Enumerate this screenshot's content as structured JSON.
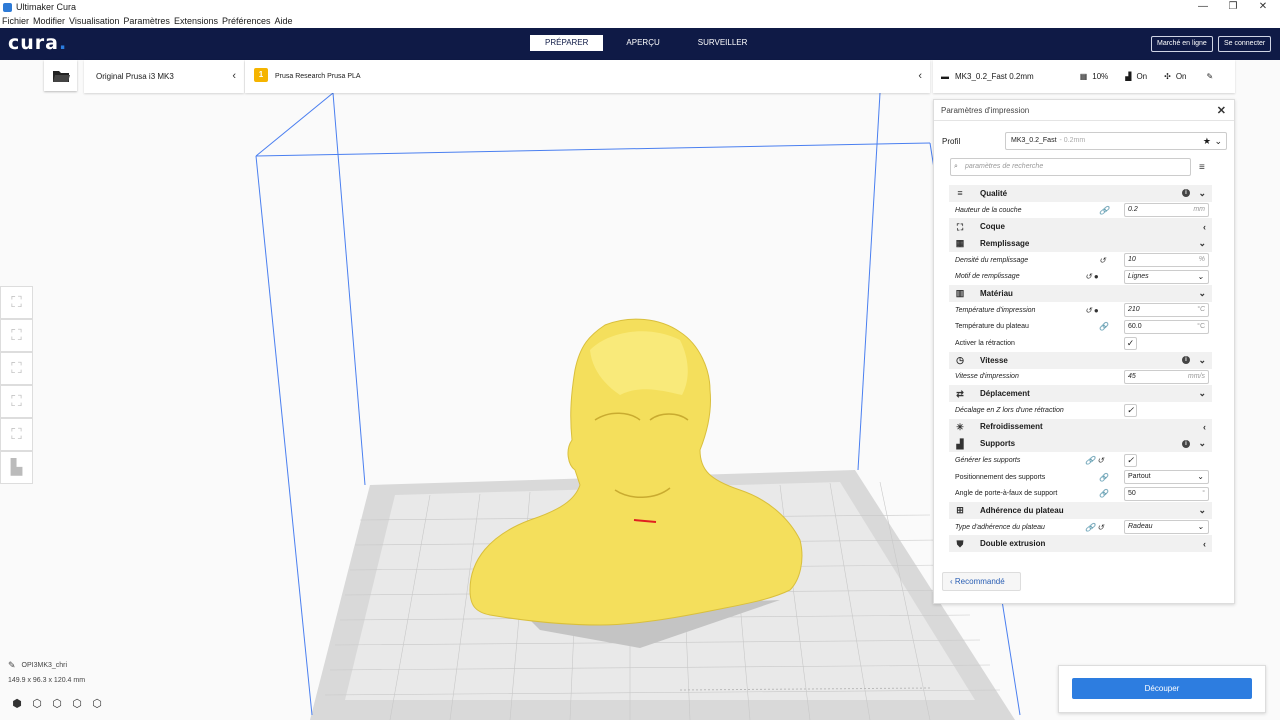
{
  "window": {
    "title": "Ultimaker Cura",
    "minimize": "—",
    "restore": "❐",
    "close": "✕"
  },
  "menu": [
    "Fichier",
    "Modifier",
    "Visualisation",
    "Paramètres",
    "Extensions",
    "Préférences",
    "Aide"
  ],
  "header": {
    "logo": "cura",
    "logo_dot": ".",
    "stages": [
      "PRÉPARER",
      "APERÇU",
      "SURVEILLER"
    ],
    "marketplace": "Marché en ligne",
    "login": "Se connecter"
  },
  "printer": {
    "name": "Original Prusa i3 MK3"
  },
  "material": {
    "badge": "1",
    "name": "Prusa Research Prusa PLA"
  },
  "summary": {
    "profile": "MK3_0.2_Fast 0.2mm",
    "infill": "10%",
    "support": "On",
    "adhesion": "On"
  },
  "panel": {
    "title": "Paramètres d'impression",
    "profile_label": "Profil",
    "profile_value": "MK3_0.2_Fast",
    "profile_sub": "- 0.2mm",
    "search_placeholder": "paramètres de recherche",
    "recommended": "Recommandé"
  },
  "settings": [
    {
      "type": "cat",
      "label": "Qualité",
      "icon": "≡",
      "info": true,
      "chev": "⌄"
    },
    {
      "type": "set",
      "label": "Hauteur de la couche",
      "italic": true,
      "icons": "🔗",
      "value": "0.2",
      "unit": "mm"
    },
    {
      "type": "cat",
      "label": "Coque",
      "icon": "⛶",
      "chev": "‹"
    },
    {
      "type": "cat",
      "label": "Remplissage",
      "icon": "▦",
      "chev": "⌄"
    },
    {
      "type": "set",
      "label": "Densité du remplissage",
      "italic": true,
      "icons": "↺",
      "value": "10",
      "unit": "%"
    },
    {
      "type": "set",
      "label": "Motif de remplissage",
      "italic": true,
      "icons": "↺ ●",
      "value": "Lignes",
      "dropdown": true
    },
    {
      "type": "cat",
      "label": "Matériau",
      "icon": "▥",
      "chev": "⌄"
    },
    {
      "type": "set",
      "label": "Température d'impression",
      "italic": true,
      "icons": "↺ ●",
      "value": "210",
      "unit": "°C"
    },
    {
      "type": "set",
      "label": "Température du plateau",
      "icons": "🔗",
      "value": "60.0",
      "unit": "°C"
    },
    {
      "type": "set",
      "label": "Activer la rétraction",
      "check": true
    },
    {
      "type": "cat",
      "label": "Vitesse",
      "icon": "◷",
      "info": true,
      "chev": "⌄"
    },
    {
      "type": "set",
      "label": "Vitesse d'impression",
      "italic": true,
      "value": "45",
      "unit": "mm/s"
    },
    {
      "type": "cat",
      "label": "Déplacement",
      "icon": "⇄",
      "chev": "⌄"
    },
    {
      "type": "set",
      "label": "Décalage en Z lors d'une rétraction",
      "italic": true,
      "check": true
    },
    {
      "type": "cat",
      "label": "Refroidissement",
      "icon": "✳",
      "chev": "‹"
    },
    {
      "type": "cat",
      "label": "Supports",
      "icon": "▟",
      "info": true,
      "chev": "⌄"
    },
    {
      "type": "set",
      "label": "Générer les supports",
      "italic": true,
      "icons": "🔗 ↺",
      "check": true
    },
    {
      "type": "set",
      "label": "Positionnement des supports",
      "icons": "🔗",
      "value": "Partout",
      "dropdown": true
    },
    {
      "type": "set",
      "label": "Angle de porte-à-faux de support",
      "icons": "🔗",
      "value": "50",
      "unit": "°"
    },
    {
      "type": "cat",
      "label": "Adhérence du plateau",
      "icon": "⊞",
      "chev": "⌄"
    },
    {
      "type": "set",
      "label": "Type d'adhérence du plateau",
      "italic": true,
      "icons": "🔗 ↺",
      "value": "Radeau",
      "dropdown": true
    },
    {
      "type": "cat",
      "label": "Double extrusion",
      "icon": "⛊",
      "chev": "‹"
    }
  ],
  "object": {
    "name": "OPI3MK3_chri",
    "dims": "149.9 x 96.3 x 120.4 mm"
  },
  "slice": {
    "label": "Découper"
  },
  "colors": {
    "header": "#0f1a46",
    "accent": "#2d7de0",
    "model": "#f7e36a",
    "volume": "#4a7ff0"
  }
}
